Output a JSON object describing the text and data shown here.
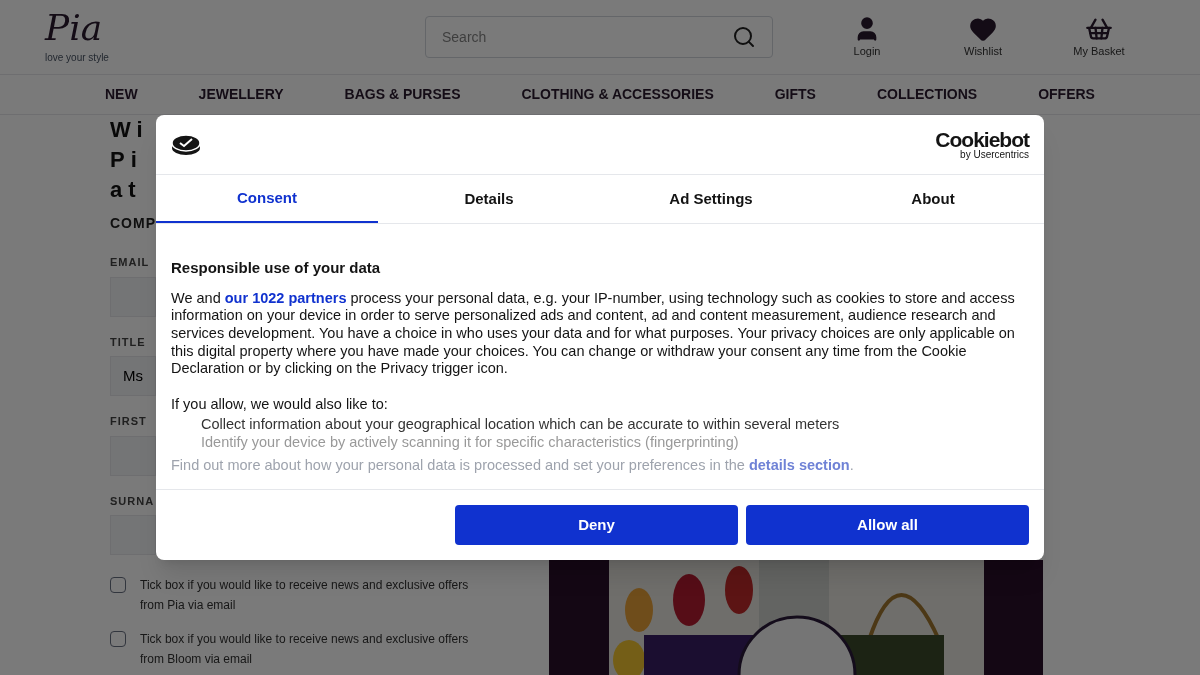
{
  "header": {
    "logo": "Pia",
    "tagline": "love your style",
    "search": {
      "placeholder": "Search"
    },
    "actions": [
      {
        "kind": "user",
        "label": "Login"
      },
      {
        "kind": "heart",
        "label": "Wishlist"
      },
      {
        "kind": "basket",
        "label": "My Basket"
      }
    ]
  },
  "nav": [
    "NEW",
    "JEWELLERY",
    "BAGS & PURSES",
    "CLOTHING & ACCESSORIES",
    "GIFTS",
    "COLLECTIONS",
    "OFFERS"
  ],
  "page": {
    "heading_lines": [
      "Wi",
      "Pi",
      "at"
    ],
    "subheading": "COMP",
    "fields": [
      {
        "label": "EMAIL"
      },
      {
        "label": "TITLE",
        "value": "Ms"
      },
      {
        "label": "FIRST"
      },
      {
        "label": "SURNA"
      }
    ],
    "checkboxes": [
      {
        "label": "Tick box if you would like to receive news and exclusive offers from Pia via email",
        "checked": false
      },
      {
        "label": "Tick box if you would like to receive news and exclusive offers from Bloom via email",
        "checked": false
      }
    ]
  },
  "dialog": {
    "brand": "Cookiebot",
    "brand_sub": "by Usercentrics",
    "tabs": [
      {
        "label": "Consent",
        "selected": true
      },
      {
        "label": "Details",
        "selected": false
      },
      {
        "label": "Ad Settings",
        "selected": false
      },
      {
        "label": "About",
        "selected": false
      }
    ],
    "title": "Responsible use of your data",
    "intro_before": "We and",
    "intro_link": "our 1022 partners",
    "intro_after": "process your personal data, e.g. your IP-number, using technology such as cookies to store and access information on your device in order to serve personalized ads and content, ad and content measurement, audience research and services development. You have a choice in who uses your data and for what purposes. Your privacy choices are only applicable on this digital property where you have made your choices. You can change or withdraw your consent any time from the Cookie Declaration or by clicking on the Privacy trigger icon.",
    "also_title": "If you allow, we would also like to:",
    "also_items": [
      "Collect information about your geographical location which can be accurate to within several meters",
      "Identify your device by actively scanning it for specific characteristics (fingerprinting)"
    ],
    "footer_before": "Find out more about how your personal data is processed and set your preferences in the",
    "footer_link": "details section",
    "footer_after": ".",
    "buttons": [
      "Deny",
      "Allow all"
    ]
  }
}
